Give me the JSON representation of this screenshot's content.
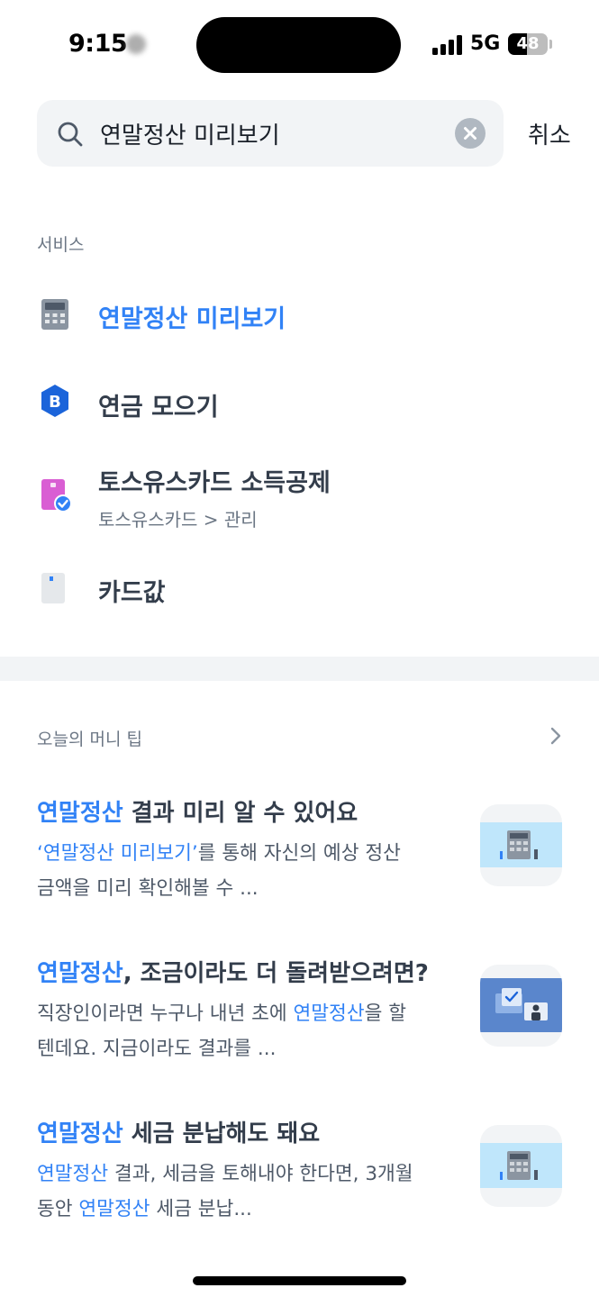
{
  "status_bar": {
    "time": "9:15",
    "network": "5G",
    "battery": "48",
    "battery_level": 0.48
  },
  "search": {
    "query": "연말정산 미리보기",
    "cancel_label": "취소"
  },
  "services": {
    "section_label": "서비스",
    "items": [
      {
        "title": "연말정산 미리보기",
        "icon": "calculator-icon",
        "highlighted": true
      },
      {
        "title": "연금 모으기",
        "icon": "pension-b-icon"
      },
      {
        "title": "토스유스카드 소득공제",
        "subtitle": "토스유스카드 > 관리",
        "icon": "youth-card-icon"
      },
      {
        "title": "카드값",
        "icon": "card-bill-icon"
      }
    ]
  },
  "tips": {
    "section_label": "오늘의 머니 팁",
    "items": [
      {
        "title_highlight": "연말정산",
        "title_rest": " 결과 미리 알 수 있어요",
        "desc_line1_hl": "‘연말정산 미리보기’",
        "desc_line1_rest": "를 통해 자신의 예상 정산",
        "desc_line2": "금액을 미리 확인해볼 수 ...",
        "thumb": "calculator-thumbnail"
      },
      {
        "title_highlight": "연말정산",
        "title_rest": ", 조금이라도 더 돌려받으려면?",
        "desc_line1_a": "직장인이라면 누구나 내년 초에 ",
        "desc_line1_hl": "연말정산",
        "desc_line1_b": "을 할",
        "desc_line2": "텐데요. 지금이라도 결과를 ...",
        "thumb": "document-check-thumbnail"
      },
      {
        "title_highlight": "연말정산",
        "title_rest": " 세금 분납해도 돼요",
        "desc_line1_hl": "연말정산",
        "desc_line1_rest": " 결과, 세금을 토해내야 한다면, 3개월",
        "desc_line2_a": "동안 ",
        "desc_line2_hl": "연말정산",
        "desc_line2_b": " 세금 분납...",
        "thumb": "calculator-thumbnail"
      }
    ]
  },
  "colors": {
    "accent": "#3182f6",
    "text_primary": "#333d4b",
    "text_secondary": "#4e5968",
    "divider": "#f2f4f6"
  }
}
